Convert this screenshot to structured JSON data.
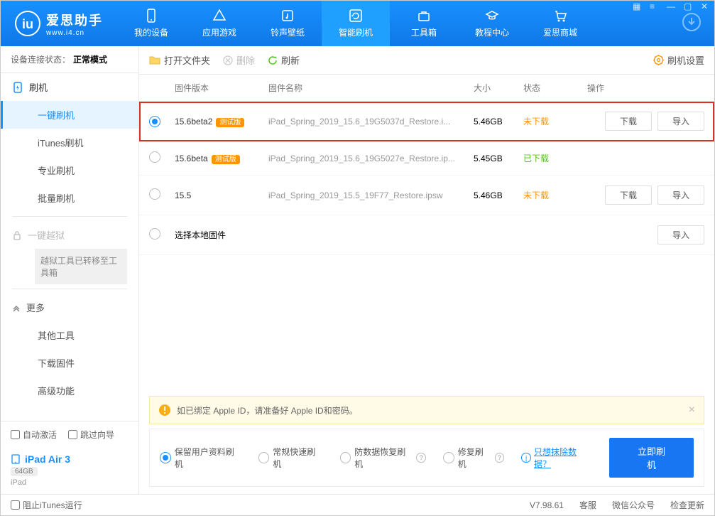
{
  "brand": {
    "name": "爱思助手",
    "url": "www.i4.cn"
  },
  "nav": {
    "tabs": [
      {
        "label": "我的设备"
      },
      {
        "label": "应用游戏"
      },
      {
        "label": "铃声壁纸"
      },
      {
        "label": "智能刷机"
      },
      {
        "label": "工具箱"
      },
      {
        "label": "教程中心"
      },
      {
        "label": "爱思商城"
      }
    ]
  },
  "device_status": {
    "label": "设备连接状态：",
    "value": "正常模式"
  },
  "sidebar": {
    "flash_header": "刷机",
    "items": [
      {
        "label": "一键刷机"
      },
      {
        "label": "iTunes刷机"
      },
      {
        "label": "专业刷机"
      },
      {
        "label": "批量刷机"
      }
    ],
    "jailbreak_header": "一键越狱",
    "jailbreak_note": "越狱工具已转移至工具箱",
    "more_header": "更多",
    "more_items": [
      {
        "label": "其他工具"
      },
      {
        "label": "下载固件"
      },
      {
        "label": "高级功能"
      }
    ],
    "check_auto": "自动激活",
    "check_skip": "跳过向导"
  },
  "device": {
    "name": "iPad Air 3",
    "storage": "64GB",
    "type": "iPad"
  },
  "toolbar": {
    "open_folder": "打开文件夹",
    "delete": "删除",
    "refresh": "刷新",
    "settings": "刷机设置"
  },
  "table": {
    "headers": {
      "version": "固件版本",
      "name": "固件名称",
      "size": "大小",
      "status": "状态",
      "actions": "操作"
    },
    "rows": [
      {
        "version": "15.6beta2",
        "beta": "测试版",
        "name": "iPad_Spring_2019_15.6_19G5037d_Restore.i...",
        "size": "5.46GB",
        "status": "未下载",
        "status_class": "orange",
        "selected": true,
        "show_actions": true,
        "highlighted": true
      },
      {
        "version": "15.6beta",
        "beta": "测试版",
        "name": "iPad_Spring_2019_15.6_19G5027e_Restore.ip...",
        "size": "5.45GB",
        "status": "已下载",
        "status_class": "green",
        "selected": false,
        "show_actions": false
      },
      {
        "version": "15.5",
        "beta": "",
        "name": "iPad_Spring_2019_15.5_19F77_Restore.ipsw",
        "size": "5.46GB",
        "status": "未下载",
        "status_class": "orange",
        "selected": false,
        "show_actions": true
      }
    ],
    "local_row": "选择本地固件",
    "btn_download": "下载",
    "btn_import": "导入"
  },
  "notice": "如已绑定 Apple ID，请准备好 Apple ID和密码。",
  "options": {
    "opt1": "保留用户资料刷机",
    "opt2": "常规快速刷机",
    "opt3": "防数据恢复刷机",
    "opt4": "修复刷机",
    "link": "只想抹除数据？",
    "flash_btn": "立即刷机"
  },
  "statusbar": {
    "block_itunes": "阻止iTunes运行",
    "version": "V7.98.61",
    "support": "客服",
    "wechat": "微信公众号",
    "update": "检查更新"
  }
}
